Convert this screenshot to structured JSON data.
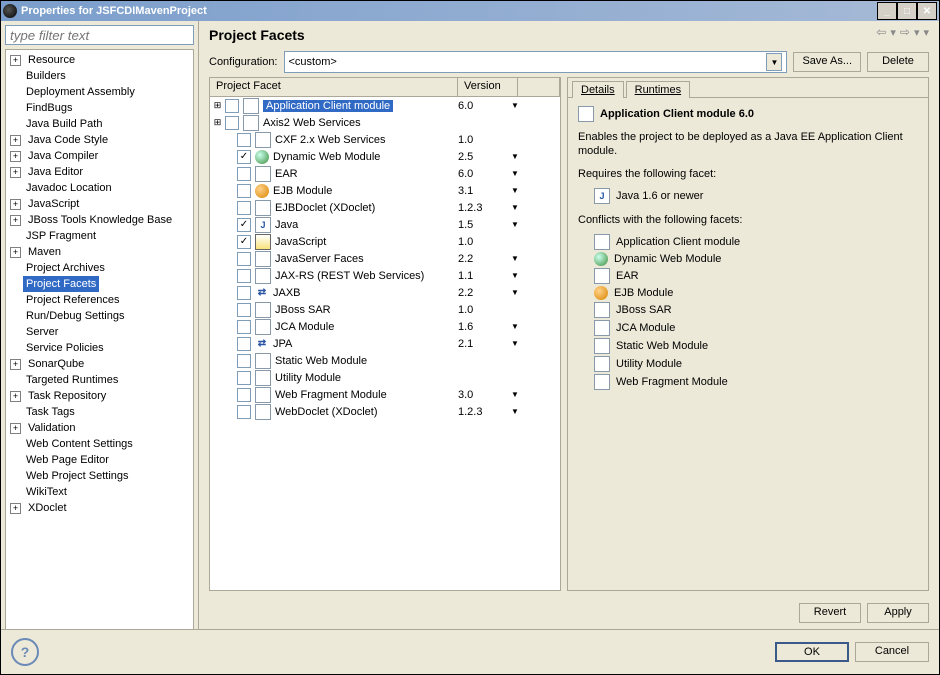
{
  "window_title": "Properties for JSFCDIMavenProject",
  "filter_placeholder": "type filter text",
  "nav_selected": "Project Facets",
  "nav": [
    {
      "label": "Resource",
      "expand": "+",
      "indent": 0
    },
    {
      "label": "Builders",
      "expand": "",
      "indent": 1
    },
    {
      "label": "Deployment Assembly",
      "expand": "",
      "indent": 1
    },
    {
      "label": "FindBugs",
      "expand": "",
      "indent": 1
    },
    {
      "label": "Java Build Path",
      "expand": "",
      "indent": 1
    },
    {
      "label": "Java Code Style",
      "expand": "+",
      "indent": 0
    },
    {
      "label": "Java Compiler",
      "expand": "+",
      "indent": 0
    },
    {
      "label": "Java Editor",
      "expand": "+",
      "indent": 0
    },
    {
      "label": "Javadoc Location",
      "expand": "",
      "indent": 1
    },
    {
      "label": "JavaScript",
      "expand": "+",
      "indent": 0
    },
    {
      "label": "JBoss Tools Knowledge Base",
      "expand": "+",
      "indent": 0
    },
    {
      "label": "JSP Fragment",
      "expand": "",
      "indent": 1
    },
    {
      "label": "Maven",
      "expand": "+",
      "indent": 0
    },
    {
      "label": "Project Archives",
      "expand": "",
      "indent": 1
    },
    {
      "label": "Project Facets",
      "expand": "",
      "indent": 1,
      "selected": true
    },
    {
      "label": "Project References",
      "expand": "",
      "indent": 1
    },
    {
      "label": "Run/Debug Settings",
      "expand": "",
      "indent": 1
    },
    {
      "label": "Server",
      "expand": "",
      "indent": 1
    },
    {
      "label": "Service Policies",
      "expand": "",
      "indent": 1
    },
    {
      "label": "SonarQube",
      "expand": "+",
      "indent": 0
    },
    {
      "label": "Targeted Runtimes",
      "expand": "",
      "indent": 1
    },
    {
      "label": "Task Repository",
      "expand": "+",
      "indent": 0
    },
    {
      "label": "Task Tags",
      "expand": "",
      "indent": 1
    },
    {
      "label": "Validation",
      "expand": "+",
      "indent": 0
    },
    {
      "label": "Web Content Settings",
      "expand": "",
      "indent": 1
    },
    {
      "label": "Web Page Editor",
      "expand": "",
      "indent": 1
    },
    {
      "label": "Web Project Settings",
      "expand": "",
      "indent": 1
    },
    {
      "label": "WikiText",
      "expand": "",
      "indent": 1
    },
    {
      "label": "XDoclet",
      "expand": "+",
      "indent": 0
    }
  ],
  "page_title": "Project Facets",
  "config_label": "Configuration:",
  "config_value": "<custom>",
  "save_as_label": "Save As...",
  "delete_label": "Delete",
  "table_header_facet": "Project Facet",
  "table_header_version": "Version",
  "facets": [
    {
      "expand": "+",
      "checked": false,
      "icon": "page",
      "label": "Application Client module",
      "version": "6.0",
      "dd": true,
      "selected": true
    },
    {
      "expand": "+",
      "checked": false,
      "icon": "page",
      "label": "Axis2 Web Services",
      "version": "",
      "dd": false
    },
    {
      "expand": "",
      "checked": false,
      "icon": "page",
      "label": "CXF 2.x Web Services",
      "version": "1.0",
      "dd": false
    },
    {
      "expand": "",
      "checked": true,
      "icon": "dwm",
      "label": "Dynamic Web Module",
      "version": "2.5",
      "dd": true
    },
    {
      "expand": "",
      "checked": false,
      "icon": "page",
      "label": "EAR",
      "version": "6.0",
      "dd": true
    },
    {
      "expand": "",
      "checked": false,
      "icon": "ejb",
      "label": "EJB Module",
      "version": "3.1",
      "dd": true
    },
    {
      "expand": "",
      "checked": false,
      "icon": "page",
      "label": "EJBDoclet (XDoclet)",
      "version": "1.2.3",
      "dd": true
    },
    {
      "expand": "",
      "checked": true,
      "icon": "java",
      "label": "Java",
      "version": "1.5",
      "dd": true
    },
    {
      "expand": "",
      "checked": true,
      "icon": "js",
      "label": "JavaScript",
      "version": "1.0",
      "dd": false
    },
    {
      "expand": "",
      "checked": false,
      "icon": "page",
      "label": "JavaServer Faces",
      "version": "2.2",
      "dd": true
    },
    {
      "expand": "",
      "checked": false,
      "icon": "page",
      "label": "JAX-RS (REST Web Services)",
      "version": "1.1",
      "dd": true
    },
    {
      "expand": "",
      "checked": false,
      "icon": "jaxb",
      "label": "JAXB",
      "version": "2.2",
      "dd": true
    },
    {
      "expand": "",
      "checked": false,
      "icon": "page",
      "label": "JBoss SAR",
      "version": "1.0",
      "dd": false
    },
    {
      "expand": "",
      "checked": false,
      "icon": "page",
      "label": "JCA Module",
      "version": "1.6",
      "dd": true
    },
    {
      "expand": "",
      "checked": false,
      "icon": "jaxb",
      "label": "JPA",
      "version": "2.1",
      "dd": true
    },
    {
      "expand": "",
      "checked": false,
      "icon": "page",
      "label": "Static Web Module",
      "version": "",
      "dd": false
    },
    {
      "expand": "",
      "checked": false,
      "icon": "page",
      "label": "Utility Module",
      "version": "",
      "dd": false
    },
    {
      "expand": "",
      "checked": false,
      "icon": "page",
      "label": "Web Fragment Module",
      "version": "3.0",
      "dd": true
    },
    {
      "expand": "",
      "checked": false,
      "icon": "page",
      "label": "WebDoclet (XDoclet)",
      "version": "1.2.3",
      "dd": true
    }
  ],
  "tabs": {
    "details": "Details",
    "runtimes": "Runtimes"
  },
  "details": {
    "heading": "Application Client module 6.0",
    "description": "Enables the project to be deployed as a Java EE Application Client module.",
    "requires_label": "Requires the following facet:",
    "requires": [
      {
        "icon": "java",
        "label": "Java 1.6 or newer"
      }
    ],
    "conflicts_label": "Conflicts with the following facets:",
    "conflicts": [
      {
        "icon": "page",
        "label": "Application Client module"
      },
      {
        "icon": "dwm",
        "label": "Dynamic Web Module"
      },
      {
        "icon": "page",
        "label": "EAR"
      },
      {
        "icon": "ejb",
        "label": "EJB Module"
      },
      {
        "icon": "page",
        "label": "JBoss SAR"
      },
      {
        "icon": "page",
        "label": "JCA Module"
      },
      {
        "icon": "page",
        "label": "Static Web Module"
      },
      {
        "icon": "page",
        "label": "Utility Module"
      },
      {
        "icon": "page",
        "label": "Web Fragment Module"
      }
    ]
  },
  "buttons": {
    "revert": "Revert",
    "apply": "Apply",
    "ok": "OK",
    "cancel": "Cancel"
  }
}
